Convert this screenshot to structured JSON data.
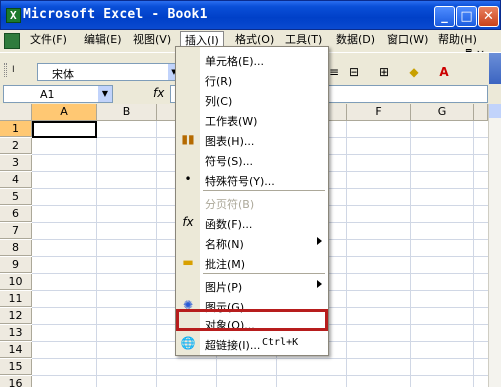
{
  "window": {
    "title": "Microsoft Excel - Book1",
    "buttons": {
      "minimize": "_",
      "maximize": "□",
      "close": "✕"
    }
  },
  "menubar": {
    "items": [
      "文件(F)",
      "编辑(E)",
      "视图(V)",
      "插入(I)",
      "格式(O)",
      "工具(T)",
      "数据(D)",
      "窗口(W)",
      "帮助(H)"
    ],
    "active": "插入(I)",
    "doc_controls": "- ♬ ×"
  },
  "toolbar": {
    "font_name": "宋体",
    "tiny_label": "Ⅰ",
    "icons": [
      "align-right-icon",
      "merge-center-icon",
      "border-icon",
      "fill-color-icon",
      "font-color-icon"
    ]
  },
  "formula_bar": {
    "name_box": "A1",
    "fx_label": "fx",
    "content": ""
  },
  "sheet": {
    "columns": [
      "A",
      "B",
      "C",
      "D",
      "E",
      "F",
      "G"
    ],
    "rows": [
      "1",
      "2",
      "3",
      "4",
      "5",
      "6",
      "7",
      "8",
      "9",
      "10",
      "11",
      "12",
      "13",
      "14",
      "15",
      "16"
    ],
    "active_cell": "A1"
  },
  "insert_menu": {
    "items": [
      {
        "label": "单元格(E)...",
        "icon": ""
      },
      {
        "label": "行(R)",
        "icon": ""
      },
      {
        "label": "列(C)",
        "icon": ""
      },
      {
        "label": "工作表(W)",
        "icon": ""
      },
      {
        "label": "图表(H)...",
        "icon": "chart-icon"
      },
      {
        "label": "符号(S)...",
        "icon": ""
      },
      {
        "label": "特殊符号(Y)...",
        "icon": "bullet-icon"
      },
      {
        "label": "分页符(B)",
        "icon": "",
        "disabled": true
      },
      {
        "label": "函数(F)...",
        "icon": "function-icon"
      },
      {
        "label": "名称(N)",
        "icon": "",
        "submenu": true
      },
      {
        "label": "批注(M)",
        "icon": "comment-icon"
      },
      {
        "label": "图片(P)",
        "icon": "",
        "submenu": true
      },
      {
        "label": "图示(G)...",
        "icon": "diagram-icon"
      },
      {
        "label": "对象(O)...",
        "icon": ""
      },
      {
        "label": "超链接(I)...",
        "icon": "hyperlink-icon",
        "shortcut": "Ctrl+K"
      }
    ],
    "highlighted": "对象(O)..."
  },
  "colors": {
    "title_bar": "#0a4fd8",
    "highlight_box": "#b71d1d",
    "selected_header": "#ffc873"
  }
}
